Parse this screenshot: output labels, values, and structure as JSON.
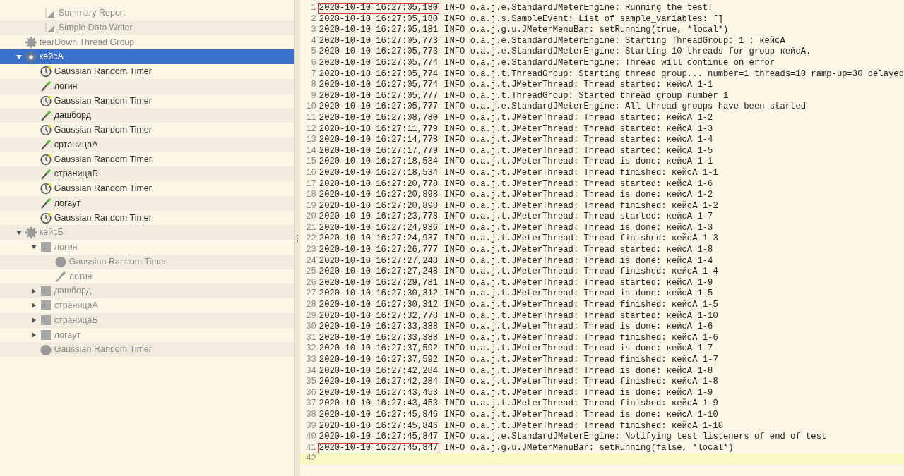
{
  "tree": {
    "scrolled_parent_children": [
      {
        "label": "Summary Report",
        "kind": "report",
        "disabled": true
      },
      {
        "label": "Simple Data Writer",
        "kind": "report",
        "disabled": true
      }
    ],
    "items": [
      {
        "label": "tearDown Thread Group",
        "kind": "thread-group",
        "disabled": true,
        "selected": false
      },
      {
        "label": "кейсА",
        "kind": "thread-group",
        "disabled": false,
        "selected": true,
        "expanded": true,
        "children": [
          {
            "label": "Gaussian Random Timer",
            "kind": "timer",
            "disabled": false,
            "selected": false
          },
          {
            "label": "логин",
            "kind": "sampler",
            "disabled": false,
            "selected": false
          },
          {
            "label": "Gaussian Random Timer",
            "kind": "timer",
            "disabled": false,
            "selected": false
          },
          {
            "label": "дашборд",
            "kind": "sampler",
            "disabled": false,
            "selected": false
          },
          {
            "label": "Gaussian Random Timer",
            "kind": "timer",
            "disabled": false,
            "selected": false
          },
          {
            "label": "сртаницаА",
            "kind": "sampler",
            "disabled": false,
            "selected": false
          },
          {
            "label": "Gaussian Random Timer",
            "kind": "timer",
            "disabled": false,
            "selected": false
          },
          {
            "label": "страницаБ",
            "kind": "sampler",
            "disabled": false,
            "selected": false
          },
          {
            "label": "Gaussian Random Timer",
            "kind": "timer",
            "disabled": false,
            "selected": false
          },
          {
            "label": "логаут",
            "kind": "sampler",
            "disabled": false,
            "selected": false
          },
          {
            "label": "Gaussian Random Timer",
            "kind": "timer",
            "disabled": false,
            "selected": false
          }
        ]
      },
      {
        "label": "кейсБ",
        "kind": "thread-group",
        "disabled": true,
        "selected": false,
        "expanded": true,
        "children": [
          {
            "label": "логин",
            "kind": "controller",
            "disabled": true,
            "selected": false,
            "expanded": true,
            "children": [
              {
                "label": "Gaussian Random Timer",
                "kind": "timer",
                "disabled": true,
                "selected": false
              },
              {
                "label": "логин",
                "kind": "sampler",
                "disabled": true,
                "selected": false
              }
            ]
          },
          {
            "label": "дашборд",
            "kind": "controller",
            "disabled": true,
            "selected": false,
            "expanded": false
          },
          {
            "label": "страницаА",
            "kind": "controller",
            "disabled": true,
            "selected": false,
            "expanded": false
          },
          {
            "label": "страницаБ",
            "kind": "controller",
            "disabled": true,
            "selected": false,
            "expanded": false
          },
          {
            "label": "логаут",
            "kind": "controller",
            "disabled": true,
            "selected": false,
            "expanded": false
          },
          {
            "label": "Gaussian Random Timer",
            "kind": "timer",
            "disabled": true,
            "selected": false
          }
        ]
      }
    ]
  },
  "log": {
    "lines": [
      {
        "number": "1",
        "timestamp": "2020-10-10 16:27:05,180",
        "message": "INFO o.a.j.e.StandardJMeterEngine: Running the test!",
        "highlighted": true
      },
      {
        "number": "2",
        "timestamp": "2020-10-10 16:27:05,180",
        "message": "INFO o.a.j.s.SampleEvent: List of sample_variables: []",
        "highlighted": false
      },
      {
        "number": "3",
        "timestamp": "2020-10-10 16:27:05,181",
        "message": "INFO o.a.j.g.u.JMeterMenuBar: setRunning(true, *local*)",
        "highlighted": false
      },
      {
        "number": "4",
        "timestamp": "2020-10-10 16:27:05,773",
        "message": "INFO o.a.j.e.StandardJMeterEngine: Starting ThreadGroup: 1 : кейсА",
        "highlighted": false
      },
      {
        "number": "5",
        "timestamp": "2020-10-10 16:27:05,773",
        "message": "INFO o.a.j.e.StandardJMeterEngine: Starting 10 threads for group кейсА.",
        "highlighted": false
      },
      {
        "number": "6",
        "timestamp": "2020-10-10 16:27:05,774",
        "message": "INFO o.a.j.e.StandardJMeterEngine: Thread will continue on error",
        "highlighted": false
      },
      {
        "number": "7",
        "timestamp": "2020-10-10 16:27:05,774",
        "message": "INFO o.a.j.t.ThreadGroup: Starting thread group... number=1 threads=10 ramp-up=30 delayed",
        "highlighted": false
      },
      {
        "number": "8",
        "timestamp": "2020-10-10 16:27:05,774",
        "message": "INFO o.a.j.t.JMeterThread: Thread started: кейсА 1-1",
        "highlighted": false
      },
      {
        "number": "9",
        "timestamp": "2020-10-10 16:27:05,777",
        "message": "INFO o.a.j.t.ThreadGroup: Started thread group number 1",
        "highlighted": false
      },
      {
        "number": "10",
        "timestamp": "2020-10-10 16:27:05,777",
        "message": "INFO o.a.j.e.StandardJMeterEngine: All thread groups have been started",
        "highlighted": false
      },
      {
        "number": "11",
        "timestamp": "2020-10-10 16:27:08,780",
        "message": "INFO o.a.j.t.JMeterThread: Thread started: кейсА 1-2",
        "highlighted": false
      },
      {
        "number": "12",
        "timestamp": "2020-10-10 16:27:11,779",
        "message": "INFO o.a.j.t.JMeterThread: Thread started: кейсА 1-3",
        "highlighted": false
      },
      {
        "number": "13",
        "timestamp": "2020-10-10 16:27:14,778",
        "message": "INFO o.a.j.t.JMeterThread: Thread started: кейсА 1-4",
        "highlighted": false
      },
      {
        "number": "14",
        "timestamp": "2020-10-10 16:27:17,779",
        "message": "INFO o.a.j.t.JMeterThread: Thread started: кейсА 1-5",
        "highlighted": false
      },
      {
        "number": "15",
        "timestamp": "2020-10-10 16:27:18,534",
        "message": "INFO o.a.j.t.JMeterThread: Thread is done: кейсА 1-1",
        "highlighted": false
      },
      {
        "number": "16",
        "timestamp": "2020-10-10 16:27:18,534",
        "message": "INFO o.a.j.t.JMeterThread: Thread finished: кейсА 1-1",
        "highlighted": false
      },
      {
        "number": "17",
        "timestamp": "2020-10-10 16:27:20,778",
        "message": "INFO o.a.j.t.JMeterThread: Thread started: кейсА 1-6",
        "highlighted": false
      },
      {
        "number": "18",
        "timestamp": "2020-10-10 16:27:20,898",
        "message": "INFO o.a.j.t.JMeterThread: Thread is done: кейсА 1-2",
        "highlighted": false
      },
      {
        "number": "19",
        "timestamp": "2020-10-10 16:27:20,898",
        "message": "INFO o.a.j.t.JMeterThread: Thread finished: кейсА 1-2",
        "highlighted": false
      },
      {
        "number": "20",
        "timestamp": "2020-10-10 16:27:23,778",
        "message": "INFO o.a.j.t.JMeterThread: Thread started: кейсА 1-7",
        "highlighted": false
      },
      {
        "number": "21",
        "timestamp": "2020-10-10 16:27:24,936",
        "message": "INFO o.a.j.t.JMeterThread: Thread is done: кейсА 1-3",
        "highlighted": false
      },
      {
        "number": "22",
        "timestamp": "2020-10-10 16:27:24,937",
        "message": "INFO o.a.j.t.JMeterThread: Thread finished: кейсА 1-3",
        "highlighted": false
      },
      {
        "number": "23",
        "timestamp": "2020-10-10 16:27:26,777",
        "message": "INFO o.a.j.t.JMeterThread: Thread started: кейсА 1-8",
        "highlighted": false
      },
      {
        "number": "24",
        "timestamp": "2020-10-10 16:27:27,248",
        "message": "INFO o.a.j.t.JMeterThread: Thread is done: кейсА 1-4",
        "highlighted": false
      },
      {
        "number": "25",
        "timestamp": "2020-10-10 16:27:27,248",
        "message": "INFO o.a.j.t.JMeterThread: Thread finished: кейсА 1-4",
        "highlighted": false
      },
      {
        "number": "26",
        "timestamp": "2020-10-10 16:27:29,781",
        "message": "INFO o.a.j.t.JMeterThread: Thread started: кейсА 1-9",
        "highlighted": false
      },
      {
        "number": "27",
        "timestamp": "2020-10-10 16:27:30,312",
        "message": "INFO o.a.j.t.JMeterThread: Thread is done: кейсА 1-5",
        "highlighted": false
      },
      {
        "number": "28",
        "timestamp": "2020-10-10 16:27:30,312",
        "message": "INFO o.a.j.t.JMeterThread: Thread finished: кейсА 1-5",
        "highlighted": false
      },
      {
        "number": "29",
        "timestamp": "2020-10-10 16:27:32,778",
        "message": "INFO o.a.j.t.JMeterThread: Thread started: кейсА 1-10",
        "highlighted": false
      },
      {
        "number": "30",
        "timestamp": "2020-10-10 16:27:33,388",
        "message": "INFO o.a.j.t.JMeterThread: Thread is done: кейсА 1-6",
        "highlighted": false
      },
      {
        "number": "31",
        "timestamp": "2020-10-10 16:27:33,388",
        "message": "INFO o.a.j.t.JMeterThread: Thread finished: кейсА 1-6",
        "highlighted": false
      },
      {
        "number": "32",
        "timestamp": "2020-10-10 16:27:37,592",
        "message": "INFO o.a.j.t.JMeterThread: Thread is done: кейсА 1-7",
        "highlighted": false
      },
      {
        "number": "33",
        "timestamp": "2020-10-10 16:27:37,592",
        "message": "INFO o.a.j.t.JMeterThread: Thread finished: кейсА 1-7",
        "highlighted": false
      },
      {
        "number": "34",
        "timestamp": "2020-10-10 16:27:42,284",
        "message": "INFO o.a.j.t.JMeterThread: Thread is done: кейсА 1-8",
        "highlighted": false
      },
      {
        "number": "35",
        "timestamp": "2020-10-10 16:27:42,284",
        "message": "INFO o.a.j.t.JMeterThread: Thread finished: кейсА 1-8",
        "highlighted": false
      },
      {
        "number": "36",
        "timestamp": "2020-10-10 16:27:43,453",
        "message": "INFO o.a.j.t.JMeterThread: Thread is done: кейсА 1-9",
        "highlighted": false
      },
      {
        "number": "37",
        "timestamp": "2020-10-10 16:27:43,453",
        "message": "INFO o.a.j.t.JMeterThread: Thread finished: кейсА 1-9",
        "highlighted": false
      },
      {
        "number": "38",
        "timestamp": "2020-10-10 16:27:45,846",
        "message": "INFO o.a.j.t.JMeterThread: Thread is done: кейсА 1-10",
        "highlighted": false
      },
      {
        "number": "39",
        "timestamp": "2020-10-10 16:27:45,846",
        "message": "INFO o.a.j.t.JMeterThread: Thread finished: кейсА 1-10",
        "highlighted": false
      },
      {
        "number": "40",
        "timestamp": "2020-10-10 16:27:45,847",
        "message": "INFO o.a.j.e.StandardJMeterEngine: Notifying test listeners of end of test",
        "highlighted": false
      },
      {
        "number": "41",
        "timestamp": "2020-10-10 16:27:45,847",
        "message": "INFO o.a.j.g.u.JMeterMenuBar: setRunning(false, *local*)",
        "highlighted": true
      },
      {
        "number": "42",
        "current": true
      }
    ]
  }
}
